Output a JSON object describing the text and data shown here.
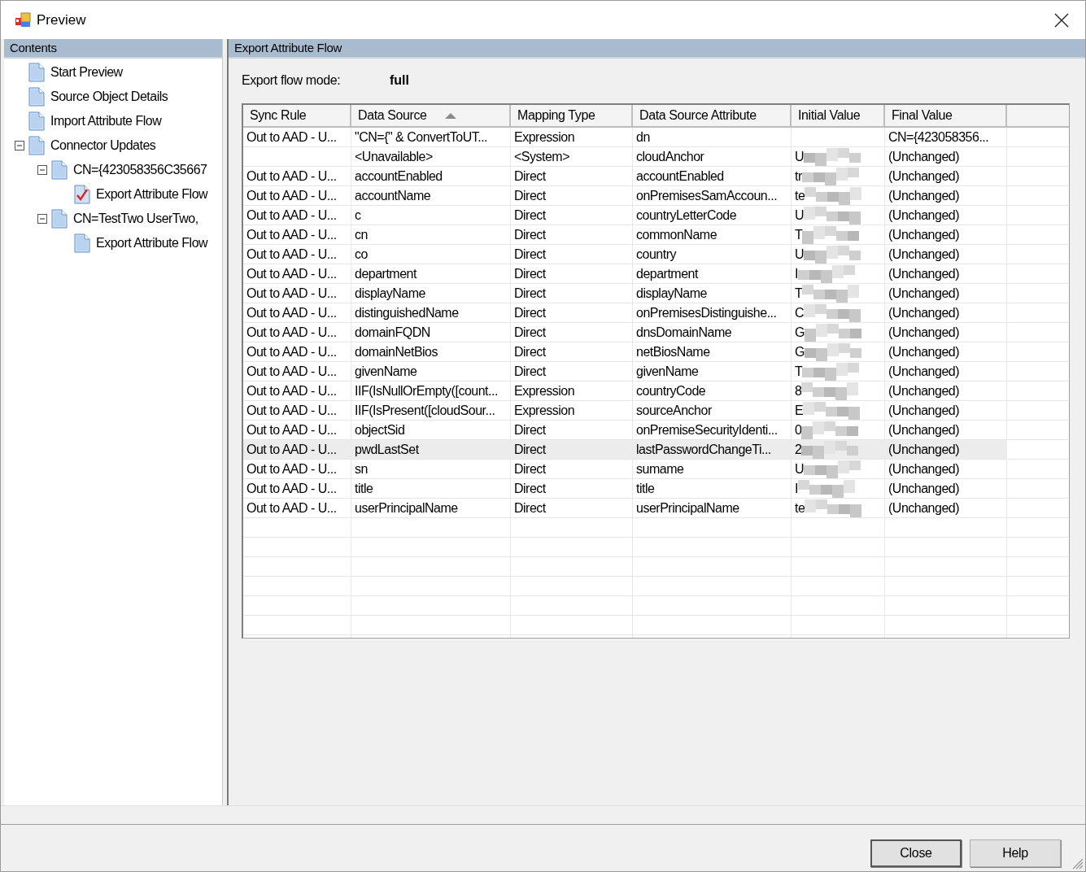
{
  "window": {
    "title": "Preview"
  },
  "sidebar": {
    "title": "Contents",
    "items": [
      {
        "label": "Start Preview",
        "kind": "page"
      },
      {
        "label": "Source Object Details",
        "kind": "page"
      },
      {
        "label": "Import Attribute Flow",
        "kind": "page"
      },
      {
        "label": "Connector Updates",
        "kind": "page",
        "expanded": true,
        "children": [
          {
            "label": "CN={423058356C35667",
            "kind": "page",
            "expanded": true,
            "children": [
              {
                "label": "Export Attribute Flow",
                "kind": "checked-page"
              }
            ]
          },
          {
            "label": "CN=TestTwo UserTwo,",
            "kind": "page",
            "expanded": true,
            "children": [
              {
                "label": "Export Attribute Flow",
                "kind": "page"
              }
            ]
          }
        ]
      }
    ]
  },
  "panel": {
    "title": "Export Attribute Flow",
    "export_flow_mode": {
      "label": "Export flow mode:",
      "value": "full"
    },
    "table": {
      "columns": [
        {
          "label": "Sync Rule",
          "sorted": false
        },
        {
          "label": "Data Source",
          "sorted": true
        },
        {
          "label": "Mapping Type",
          "sorted": false
        },
        {
          "label": "Data Source Attribute",
          "sorted": false
        },
        {
          "label": "Initial Value",
          "sorted": false
        },
        {
          "label": "Final Value",
          "sorted": false
        }
      ],
      "rows": [
        {
          "cells": [
            "Out to AAD - U...",
            "\"CN={\" & ConvertToUT...",
            "Expression",
            "dn",
            "",
            "CN={423058356..."
          ],
          "redacted": false,
          "selected": false
        },
        {
          "cells": [
            "",
            "<Unavailable>",
            "<System>",
            "cloudAnchor",
            "U",
            "(Unchanged)"
          ],
          "redacted": true,
          "selected": false
        },
        {
          "cells": [
            "Out to AAD - U...",
            "accountEnabled",
            "Direct",
            "accountEnabled",
            "tr",
            "(Unchanged)"
          ],
          "redacted": true,
          "selected": false
        },
        {
          "cells": [
            "Out to AAD - U...",
            "accountName",
            "Direct",
            "onPremisesSamAccoun...",
            "te",
            "(Unchanged)"
          ],
          "redacted": true,
          "selected": false
        },
        {
          "cells": [
            "Out to AAD - U...",
            "c",
            "Direct",
            "countryLetterCode",
            "U",
            "(Unchanged)"
          ],
          "redacted": true,
          "selected": false
        },
        {
          "cells": [
            "Out to AAD - U...",
            "cn",
            "Direct",
            "commonName",
            "T",
            "(Unchanged)"
          ],
          "redacted": true,
          "selected": false
        },
        {
          "cells": [
            "Out to AAD - U...",
            "co",
            "Direct",
            "country",
            "U",
            "(Unchanged)"
          ],
          "redacted": true,
          "selected": false
        },
        {
          "cells": [
            "Out to AAD - U...",
            "department",
            "Direct",
            "department",
            "I",
            "(Unchanged)"
          ],
          "redacted": true,
          "selected": false
        },
        {
          "cells": [
            "Out to AAD - U...",
            "displayName",
            "Direct",
            "displayName",
            "T",
            "(Unchanged)"
          ],
          "redacted": true,
          "selected": false
        },
        {
          "cells": [
            "Out to AAD - U...",
            "distinguishedName",
            "Direct",
            "onPremisesDistinguishe...",
            "C",
            "(Unchanged)"
          ],
          "redacted": true,
          "selected": false
        },
        {
          "cells": [
            "Out to AAD - U...",
            "domainFQDN",
            "Direct",
            "dnsDomainName",
            "G",
            "(Unchanged)"
          ],
          "redacted": true,
          "selected": false
        },
        {
          "cells": [
            "Out to AAD - U...",
            "domainNetBios",
            "Direct",
            "netBiosName",
            "G",
            "(Unchanged)"
          ],
          "redacted": true,
          "selected": false
        },
        {
          "cells": [
            "Out to AAD - U...",
            "givenName",
            "Direct",
            "givenName",
            "T",
            "(Unchanged)"
          ],
          "redacted": true,
          "selected": false
        },
        {
          "cells": [
            "Out to AAD - U...",
            "IIF(IsNullOrEmpty([count...",
            "Expression",
            "countryCode",
            "8",
            "(Unchanged)"
          ],
          "redacted": true,
          "selected": false
        },
        {
          "cells": [
            "Out to AAD - U...",
            "IIF(IsPresent([cloudSour...",
            "Expression",
            "sourceAnchor",
            "E",
            "(Unchanged)"
          ],
          "redacted": true,
          "selected": false
        },
        {
          "cells": [
            "Out to AAD - U...",
            "objectSid",
            "Direct",
            "onPremiseSecurityIdenti...",
            "0",
            "(Unchanged)"
          ],
          "redacted": true,
          "selected": false
        },
        {
          "cells": [
            "Out to AAD - U...",
            "pwdLastSet",
            "Direct",
            "lastPasswordChangeTi...",
            "2",
            "(Unchanged)"
          ],
          "redacted": true,
          "selected": true
        },
        {
          "cells": [
            "Out to AAD - U...",
            "sn",
            "Direct",
            "sumame",
            "U",
            "(Unchanged)"
          ],
          "redacted": true,
          "selected": false
        },
        {
          "cells": [
            "Out to AAD - U...",
            "title",
            "Direct",
            "title",
            "I",
            "(Unchanged)"
          ],
          "redacted": true,
          "selected": false
        },
        {
          "cells": [
            "Out to AAD - U...",
            "userPrincipalName",
            "Direct",
            "userPrincipalName",
            "te",
            "(Unchanged)"
          ],
          "redacted": true,
          "selected": false
        }
      ]
    }
  },
  "buttons": [
    {
      "label": "Close",
      "default": true
    },
    {
      "label": "Help",
      "default": false
    }
  ]
}
